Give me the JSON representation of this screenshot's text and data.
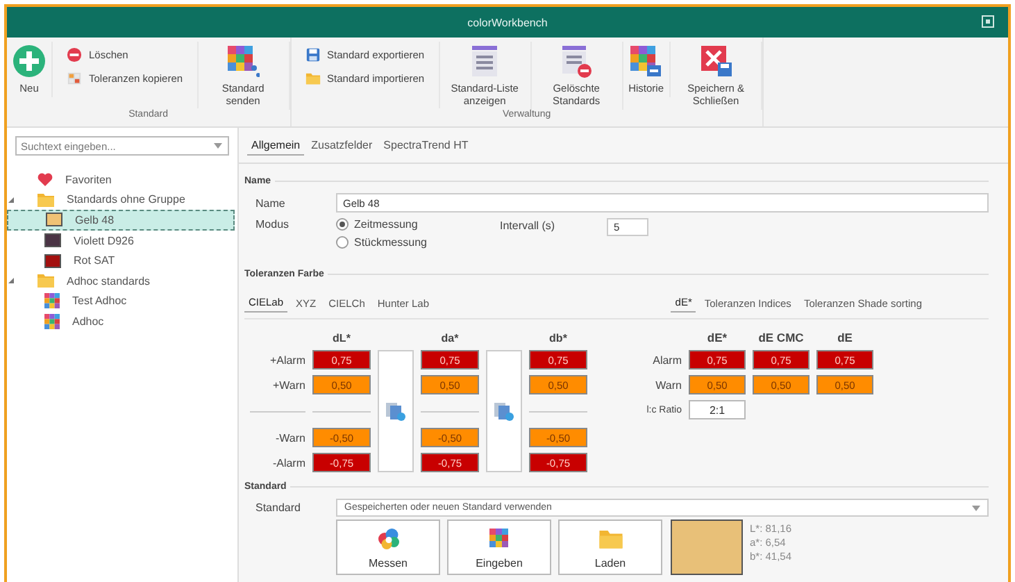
{
  "window": {
    "title": "colorWorkbench"
  },
  "ribbon": {
    "groups": [
      {
        "label": "Standard",
        "items": [
          {
            "kind": "large",
            "label": "Neu"
          },
          {
            "kind": "stack",
            "items": [
              {
                "label": "Löschen"
              },
              {
                "label": "Toleranzen kopieren"
              }
            ]
          },
          {
            "kind": "large",
            "label": "Standard senden"
          }
        ]
      },
      {
        "label": "Verwaltung",
        "items": [
          {
            "kind": "stack",
            "items": [
              {
                "label": "Standard exportieren"
              },
              {
                "label": "Standard importieren"
              }
            ]
          },
          {
            "kind": "large",
            "label": "Standard-Liste anzeigen"
          },
          {
            "kind": "large",
            "label": "Gelöschte Standards"
          },
          {
            "kind": "large",
            "label": "Historie"
          },
          {
            "kind": "large",
            "label": "Speichern & Schließen"
          }
        ]
      }
    ]
  },
  "sidebar": {
    "search": {
      "placeholder": "Suchtext eingeben..."
    },
    "tree": [
      {
        "label": "Favoriten",
        "kind": "favorites",
        "selected": false
      },
      {
        "label": "Standards ohne Gruppe",
        "kind": "folder",
        "selected": false,
        "expanded": true,
        "children": [
          {
            "label": "Gelb 48",
            "kind": "swatch",
            "color": "#f0c275",
            "selected": true
          },
          {
            "label": "Violett D926",
            "kind": "swatch",
            "color": "#4b3445",
            "selected": false
          },
          {
            "label": "Rot SAT",
            "kind": "swatch",
            "color": "#a3100f",
            "selected": false
          }
        ]
      },
      {
        "label": "Adhoc standards",
        "kind": "folder",
        "selected": false,
        "expanded": true,
        "children": [
          {
            "label": "Test Adhoc",
            "kind": "adhoc",
            "selected": false
          },
          {
            "label": "Adhoc",
            "kind": "adhoc",
            "selected": false
          }
        ]
      }
    ]
  },
  "tabs": [
    {
      "label": "Allgemein",
      "selected": true
    },
    {
      "label": "Zusatzfelder",
      "selected": false
    },
    {
      "label": "SpectraTrend HT",
      "selected": false
    }
  ],
  "name_section": {
    "legend": "Name",
    "name_label": "Name",
    "name_value": "Gelb 48",
    "mode_label": "Modus",
    "modes": [
      {
        "label": "Zeitmessung",
        "selected": true
      },
      {
        "label": "Stückmessung",
        "selected": false
      }
    ],
    "interval_label": "Intervall (s)",
    "interval_value": "5"
  },
  "tolerances": {
    "legend": "Toleranzen Farbe",
    "left_tabs": [
      {
        "label": "CIELab",
        "selected": true
      },
      {
        "label": "XYZ",
        "selected": false
      },
      {
        "label": "CIELCh",
        "selected": false
      },
      {
        "label": "Hunter Lab",
        "selected": false
      }
    ],
    "right_tabs": [
      {
        "label": "dE*",
        "selected": true
      },
      {
        "label": "Toleranzen Indices",
        "selected": false
      },
      {
        "label": "Toleranzen Shade sorting",
        "selected": false
      }
    ],
    "lab_grid": {
      "columns": [
        "dL*",
        "da*",
        "db*"
      ],
      "plus_rows": [
        {
          "label": "+Alarm",
          "kind": "alarm",
          "values": [
            "0,75",
            "0,75",
            "0,75"
          ]
        },
        {
          "label": "+Warn",
          "kind": "warn",
          "values": [
            "0,50",
            "0,50",
            "0,50"
          ]
        }
      ],
      "minus_rows": [
        {
          "label": "-Warn",
          "kind": "warn",
          "values": [
            "-0,50",
            "-0,50",
            "-0,50"
          ]
        },
        {
          "label": "-Alarm",
          "kind": "alarm",
          "values": [
            "-0,75",
            "-0,75",
            "-0,75"
          ]
        }
      ]
    },
    "de_grid": {
      "columns": [
        "dE*",
        "dE CMC",
        "dE"
      ],
      "rows": [
        {
          "label": "Alarm",
          "kind": "alarm",
          "values": [
            "0,75",
            "0,75",
            "0,75"
          ]
        },
        {
          "label": "Warn",
          "kind": "warn",
          "values": [
            "0,50",
            "0,50",
            "0,50"
          ]
        }
      ],
      "ratio": {
        "label": "l:c Ratio",
        "value": "2:1"
      }
    }
  },
  "standard_section": {
    "legend": "Standard",
    "label": "Standard",
    "dropdown_value": "Gespeicherten oder neuen Standard verwenden",
    "buttons": [
      {
        "label": "Messen"
      },
      {
        "label": "Eingeben"
      },
      {
        "label": "Laden"
      }
    ],
    "swatch": {
      "color": "#e8c078"
    },
    "values": [
      "L*: 81,16",
      "a*: 6,54",
      "b*: 41,54"
    ]
  }
}
